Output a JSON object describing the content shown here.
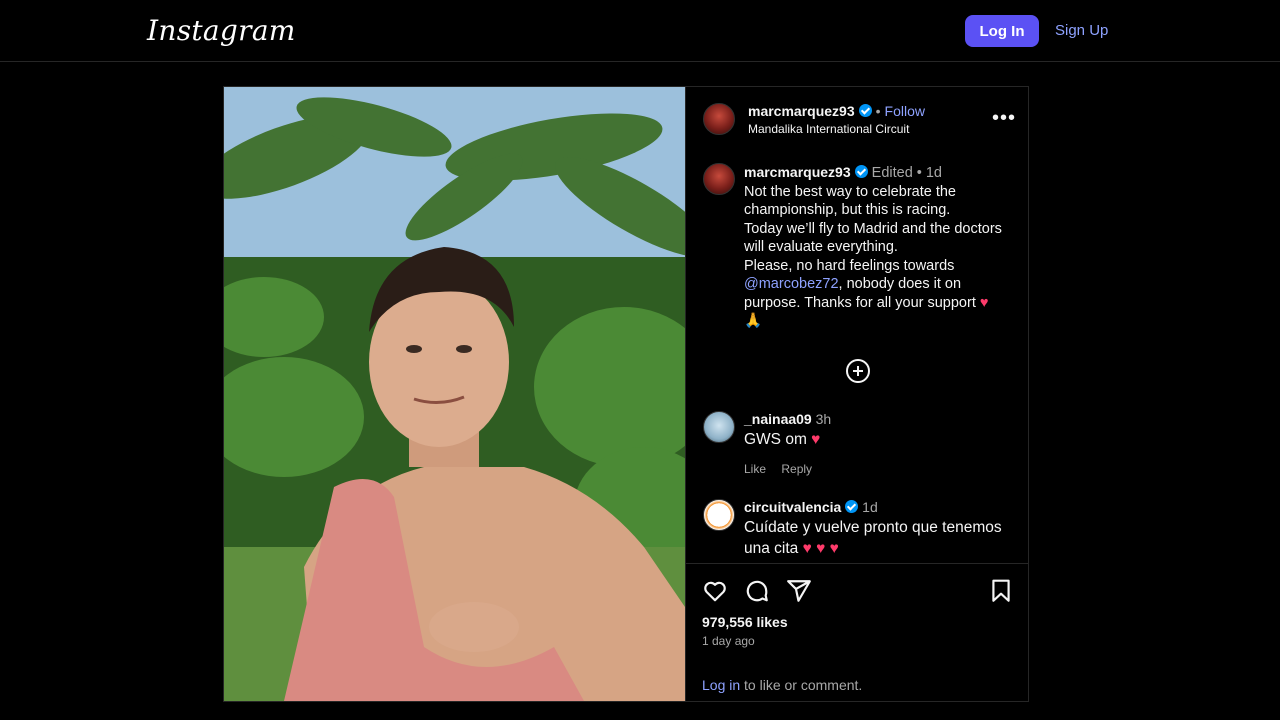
{
  "topbar": {
    "logo": "Instagram",
    "login_label": "Log In",
    "signup_label": "Sign Up"
  },
  "post": {
    "author": {
      "username": "marcmarquez93",
      "follow_label": "Follow",
      "location": "Mandalika International Circuit"
    },
    "caption": {
      "username": "marcmarquez93",
      "edited": "Edited",
      "time": "1d",
      "line1": "Not the best way to celebrate the championship, but this is racing.",
      "line2": "Today we’ll fly to Madrid and the doctors will evaluate everything.",
      "line3_before": "Please, no hard feelings towards ",
      "mention": "@marcobez72",
      "line3_after": ", nobody does it on purpose. Thanks for all your support ",
      "emoji_heart": "♥",
      "emoji_pray": "🙏"
    },
    "comments": [
      {
        "username": "_nainaa09",
        "time": "3h",
        "text": "GWS om ",
        "emoji": "♥",
        "like_label": "Like",
        "reply_label": "Reply"
      },
      {
        "username": "circuitvalencia",
        "time": "1d",
        "text": "Cuídate y vuelve pronto que tenemos una cita ",
        "emoji": "♥ ♥ ♥"
      }
    ],
    "likes": "979,556 likes",
    "posted_ago": "1 day ago",
    "login_prompt_link": "Log in",
    "login_prompt_rest": " to like or comment."
  },
  "colors": {
    "accent": "#5b51f4",
    "link": "#8ea2ff",
    "verified": "#0095f6",
    "heart": "#ff3b6b"
  },
  "icons": [
    "heart-icon",
    "comment-icon",
    "share-icon",
    "bookmark-icon",
    "more-icon",
    "verified-icon",
    "add-comment-icon"
  ]
}
